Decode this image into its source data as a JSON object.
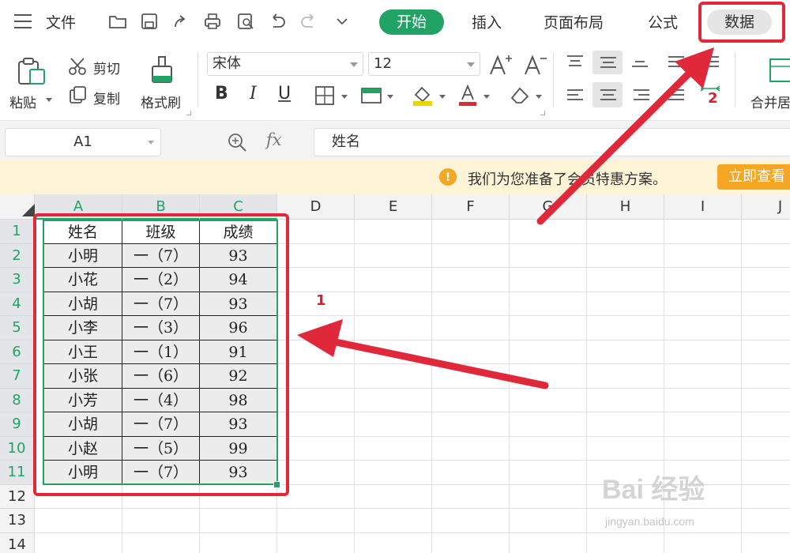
{
  "menu": {
    "file": "文件",
    "tabs": [
      "开始",
      "插入",
      "页面布局",
      "公式",
      "数据"
    ],
    "active_tab": "开始",
    "highlighted_tab": "数据"
  },
  "ribbon": {
    "paste": "粘贴",
    "cut": "剪切",
    "copy": "复制",
    "format_painter": "格式刷",
    "font_name": "宋体",
    "font_size": "12",
    "bold": "B",
    "italic": "I",
    "underline": "U",
    "merge_center": "合并居"
  },
  "formula_bar": {
    "cell_ref": "A1",
    "fx": "fx",
    "content": "姓名"
  },
  "notice": {
    "icon": "!",
    "text": "我们为您准备了会员特惠方案。",
    "button": "立即查看"
  },
  "sheet": {
    "columns": [
      "A",
      "B",
      "C",
      "D",
      "E",
      "F",
      "G",
      "H",
      "I",
      "J"
    ],
    "rows": [
      "1",
      "2",
      "3",
      "4",
      "5",
      "6",
      "7",
      "8",
      "9",
      "10",
      "11",
      "12",
      "13",
      "14"
    ],
    "table": [
      [
        "姓名",
        "班级",
        "成绩"
      ],
      [
        "小明",
        "一（7）",
        "93"
      ],
      [
        "小花",
        "一（2）",
        "94"
      ],
      [
        "小胡",
        "一（7）",
        "93"
      ],
      [
        "小李",
        "一（3）",
        "96"
      ],
      [
        "小王",
        "一（1）",
        "91"
      ],
      [
        "小张",
        "一（6）",
        "92"
      ],
      [
        "小芳",
        "一（4）",
        "98"
      ],
      [
        "小胡",
        "一（7）",
        "93"
      ],
      [
        "小赵",
        "一（5）",
        "99"
      ],
      [
        "小明",
        "一（7）",
        "93"
      ]
    ]
  },
  "annotations": {
    "step1": "1",
    "step2": "2",
    "color": "#e0283b"
  },
  "watermark": {
    "main": "Bai 经验",
    "sub": "jingyan.baidu.com"
  },
  "colors": {
    "accent": "#21a366",
    "notice_bg": "#fdf3d7",
    "notice_button": "#f5a623"
  }
}
